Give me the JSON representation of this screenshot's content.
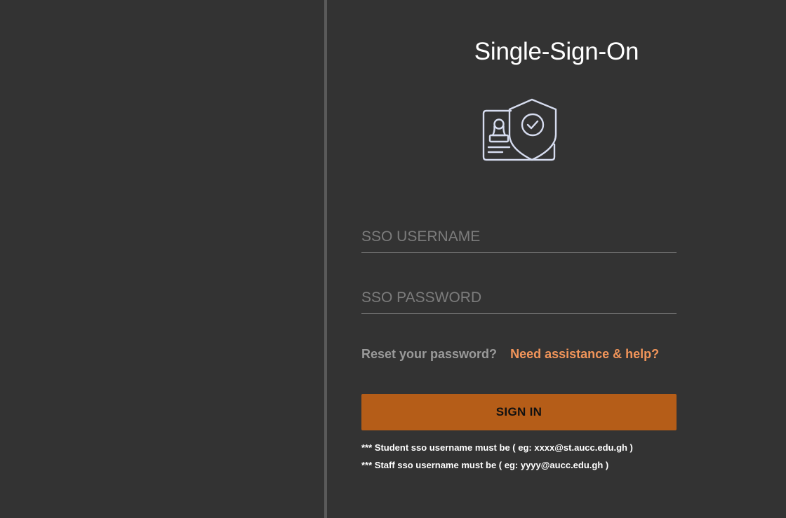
{
  "login": {
    "title": "Single-Sign-On",
    "icon": "id-card-shield-icon",
    "username_placeholder": "SSO USERNAME",
    "username_value": "",
    "password_placeholder": "SSO PASSWORD",
    "password_value": "",
    "reset_link": "Reset your password?",
    "help_link": "Need assistance & help?",
    "signin_label": "SIGN IN",
    "note_student": "*** Student sso username must be ( eg: xxxx@st.aucc.edu.gh )",
    "note_staff": "*** Staff sso username must be ( eg: yyyy@aucc.edu.gh )"
  },
  "colors": {
    "background": "#333333",
    "divider": "#5a5a5a",
    "accent_button": "#b55d18",
    "help_link": "#f2955a",
    "reset_link": "#9a9a9a",
    "icon_stroke": "#d6dcef"
  }
}
